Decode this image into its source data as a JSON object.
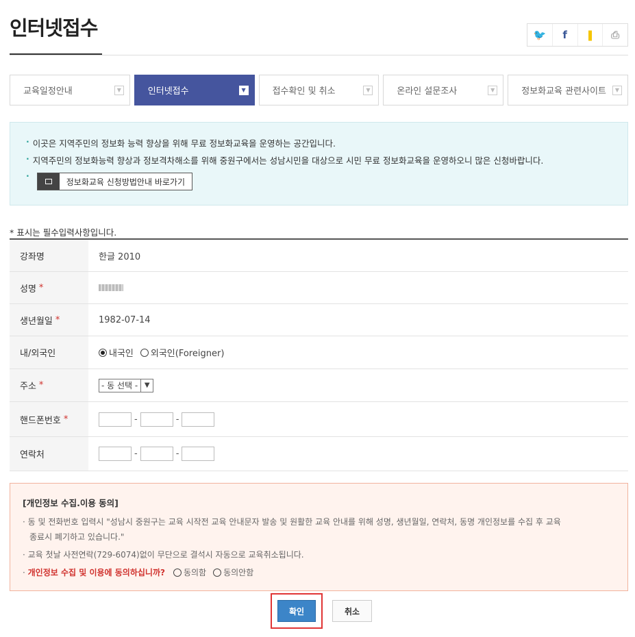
{
  "page": {
    "title": "인터넷접수"
  },
  "share": {
    "twitter_glyph": "🐦",
    "facebook_glyph": "f",
    "kakao_glyph": "❚",
    "print_glyph": "⎙"
  },
  "tabs": [
    {
      "label": "교육일정안내"
    },
    {
      "label": "인터넷접수"
    },
    {
      "label": "접수확인 및 취소"
    },
    {
      "label": "온라인 설문조사"
    },
    {
      "label": "정보화교육 관련사이트"
    }
  ],
  "info": {
    "line1": "이곳은 지역주민의 정보화 능력 향상을 위해 무료 정보화교육을 운영하는 공간입니다.",
    "line2": "지역주민의 정보화능력 향상과 정보격차해소를 위해 중원구에서는 성남시민을 대상으로 시민 무료 정보화교육을 운영하오니 많은 신청바랍니다.",
    "guide_button": "정보화교육 신청방법안내 바로가기"
  },
  "required_note": "* 표시는 필수입력사항입니다.",
  "form": {
    "course_label": "강좌명",
    "course_value": "한글 2010",
    "name_label": "성명",
    "birth_label": "생년월일",
    "birth_value": "1982-07-14",
    "nationality_label": "내/외국인",
    "nationality_options": [
      "내국인",
      "외국인(Foreigner)"
    ],
    "nationality_selected": "내국인",
    "address_label": "주소",
    "address_select": "- 동 선택 -",
    "mobile_label": "핸드폰번호",
    "contact_label": "연락처",
    "required_mark": "*",
    "dash": "-"
  },
  "consent": {
    "title": "[개인정보 수집.이용 동의]",
    "line1": "동 및 전화번호 입력시 \"성남시 중원구는 교육 시작전 교육 안내문자 발송 및 원활한 교육 안내를 위해 성명, 생년월일, 연락처, 동명 개인정보를 수집 후 교육",
    "line1b": "종료시 폐기하고 있습니다.\"",
    "line2": "교육 첫날 사전연락(729-6074)없이 무단으로 결석시 자동으로 교육취소됩니다.",
    "question": "개인정보 수집 및 이용에 동의하십니까?",
    "agree": "동의함",
    "disagree": "동의안함"
  },
  "buttons": {
    "confirm": "확인",
    "cancel": "취소"
  },
  "colors": {
    "active_tab": "#45559e",
    "info_bg": "#e9f7f9",
    "consent_bg": "#fff3ee",
    "confirm": "#3c85c8",
    "highlight": "#e03434"
  }
}
